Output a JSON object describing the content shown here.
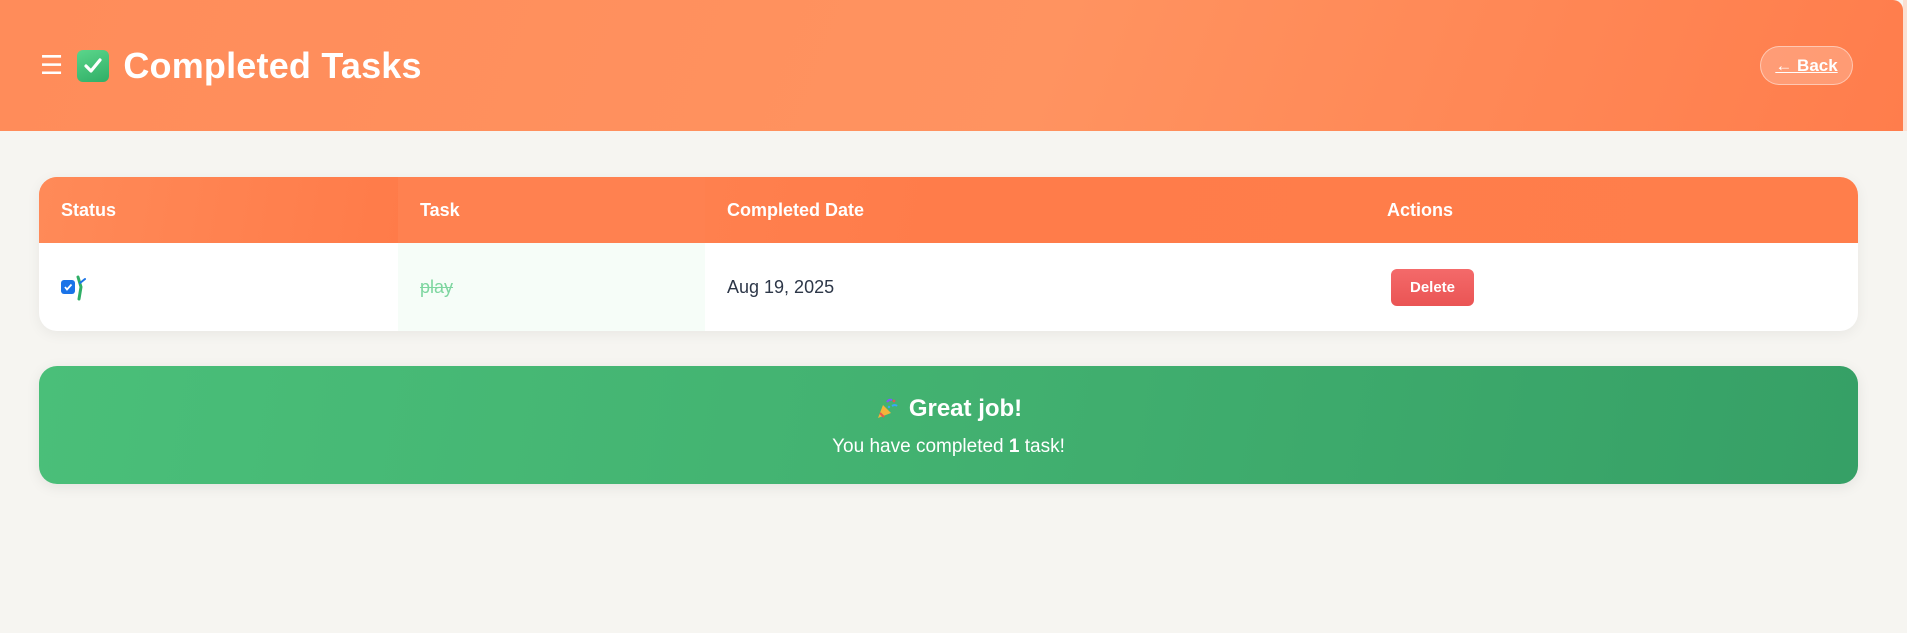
{
  "header": {
    "menu_icon": "hamburger-icon",
    "title_icon": "check-box-icon",
    "title": "Completed Tasks",
    "back_label": "← Back"
  },
  "table": {
    "columns": [
      "Status",
      "Task",
      "Completed Date",
      "Actions"
    ],
    "rows": [
      {
        "status_icon": "checked-icon",
        "task": "play",
        "completed_date": "Aug 19, 2025",
        "action_label": "Delete"
      }
    ]
  },
  "summary": {
    "icon": "party-popper-icon",
    "title": "Great job!",
    "text_prefix": "You have completed ",
    "count": "1",
    "text_suffix": " task!"
  },
  "colors": {
    "header": "#ff8c5a",
    "success": "#42b170",
    "danger": "#ea5454",
    "background": "#f6f5f1"
  }
}
